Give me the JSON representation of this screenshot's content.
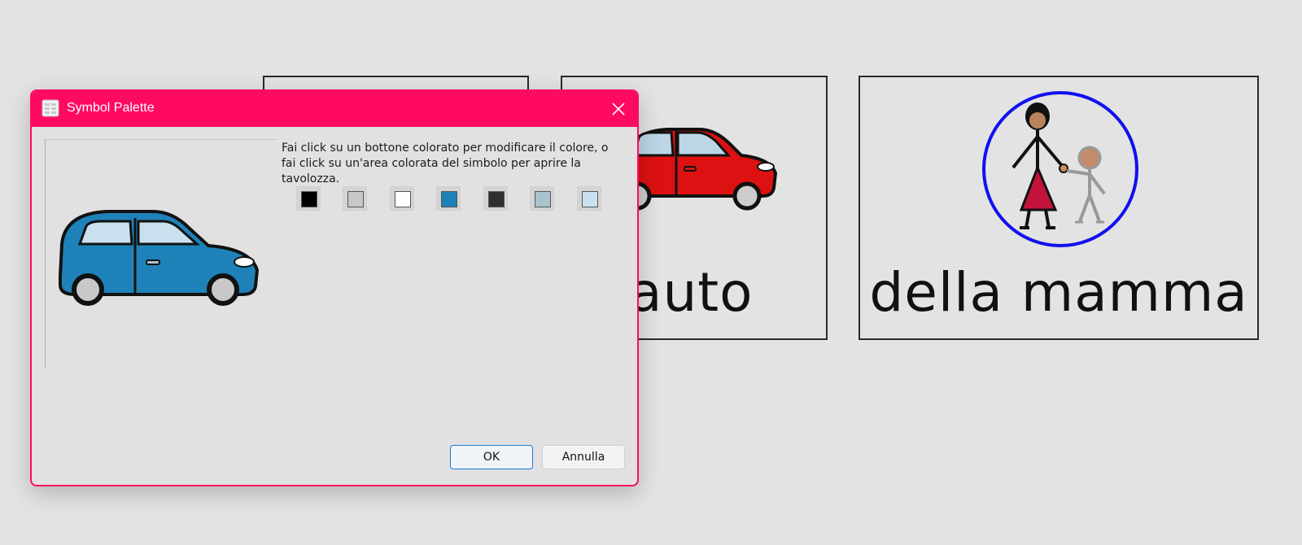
{
  "background_cards": [
    {
      "word": ""
    },
    {
      "word": "auto"
    },
    {
      "word": "della mamma"
    }
  ],
  "dialog": {
    "title": "Symbol Palette",
    "instructions": "Fai click su un bottone colorato per modificare il colore, o fai click su un'area colorata del simbolo per aprire la tavolozza.",
    "swatches": [
      {
        "color": "#000000"
      },
      {
        "color": "#c8c8c8"
      },
      {
        "color": "#ffffff"
      },
      {
        "color": "#1e82b9"
      },
      {
        "color": "#2f2f2f"
      },
      {
        "color": "#a9c4cf"
      },
      {
        "color": "#c9e0ef"
      }
    ],
    "ok_label": "OK",
    "cancel_label": "Annulla"
  },
  "colors": {
    "accent": "#ff0a63",
    "car_blue": "#1e82b9",
    "car_red": "#dd1111",
    "circle_blue": "#1111ee"
  }
}
